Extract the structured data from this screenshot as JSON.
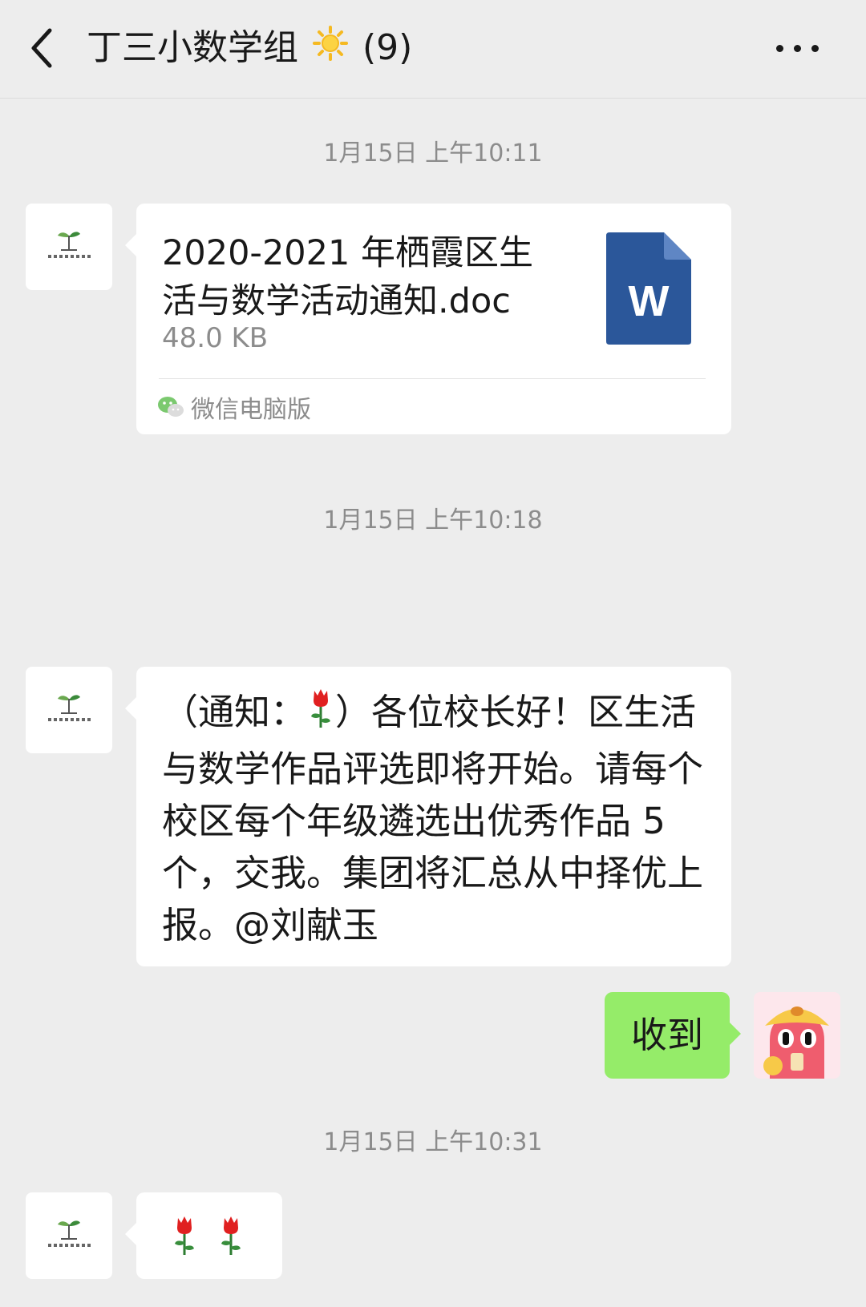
{
  "header": {
    "title": "丁三小数学组",
    "member_count": "(9)"
  },
  "timestamps": [
    "1月15日 上午10:11",
    "1月15日 上午10:18",
    "1月15日 上午10:31"
  ],
  "messages": {
    "file": {
      "name": "2020-2021 年栖霞区生活与数学活动通知.doc",
      "size": "48.0 KB",
      "icon_letter": "W",
      "source": "微信电脑版"
    },
    "notice": {
      "prefix": "（通知：",
      "body": "）各位校长好！区生活与数学作品评选即将开始。请每个校区每个年级遴选出优秀作品 5 个，交我。集团将汇总从中择优上报。@刘献玉"
    },
    "reply": {
      "text": "收到"
    },
    "roses": {
      "icons": [
        "rose-icon",
        "rose-icon"
      ]
    }
  },
  "colors": {
    "background": "#ededed",
    "bubble_self": "#95ec69",
    "bubble_other": "#ffffff",
    "word_blue": "#2b579a"
  }
}
